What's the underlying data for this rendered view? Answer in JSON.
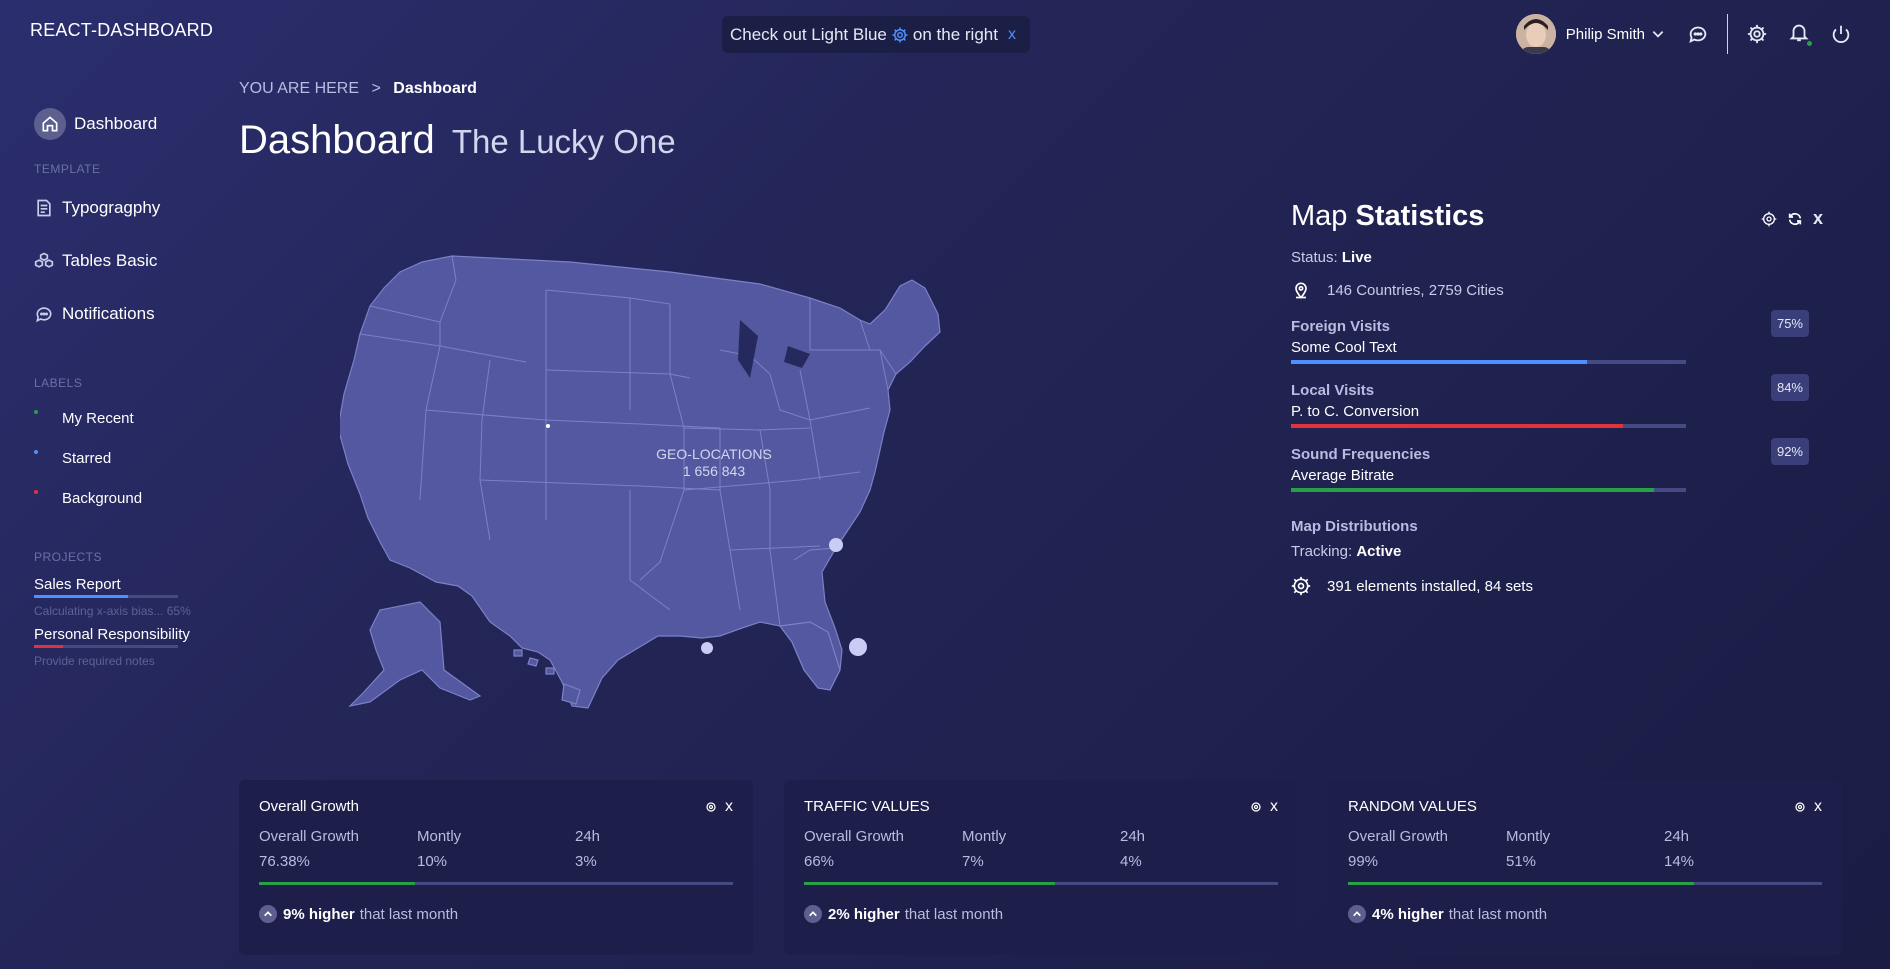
{
  "app": {
    "brand": "REACT-DASHBOARD"
  },
  "toast": {
    "text_before": "Check out Light Blue",
    "text_after": "on the right",
    "close": "x"
  },
  "user": {
    "name": "Philip Smith"
  },
  "sidebar": {
    "items": [
      {
        "label": "Dashboard",
        "icon": "home-icon",
        "active": true
      },
      {
        "label": "Typogragphy",
        "icon": "document-icon"
      },
      {
        "label": "Tables Basic",
        "icon": "cubes-icon"
      },
      {
        "label": "Notifications",
        "icon": "chat-icon"
      }
    ],
    "template_heading": "TEMPLATE",
    "labels_heading": "LABELS",
    "labels": [
      {
        "label": "My Recent",
        "color": "#27a046"
      },
      {
        "label": "Starred",
        "color": "#4d90fe"
      },
      {
        "label": "Background",
        "color": "#e0343d"
      }
    ],
    "projects_heading": "PROJECTS",
    "projects": [
      {
        "name": "Sales Report",
        "note": "Calculating x-axis bias... 65%",
        "progress": 0.65,
        "color": "#4d90fe"
      },
      {
        "name": "Personal Responsibility",
        "note": "Provide required notes",
        "progress": 0.2,
        "color": "#e0343d"
      }
    ]
  },
  "breadcrumb": {
    "prefix": "YOU ARE HERE",
    "separator": ">",
    "current": "Dashboard"
  },
  "page": {
    "title": "Dashboard",
    "subtitle": "The Lucky One"
  },
  "map": {
    "label_line1": "GEO-LOCATIONS",
    "label_line2": "1 656 843"
  },
  "stats": {
    "title_light": "Map",
    "title_bold": "Statistics",
    "close": "x",
    "status_label": "Status:",
    "status_value": "Live",
    "locations": "146 Countries, 2759 Cities",
    "metrics": [
      {
        "title": "Foreign Visits",
        "subtitle": "Some Cool Text",
        "percent_label": "75%",
        "value": 0.75,
        "color": "#4d90fe"
      },
      {
        "title": "Local Visits",
        "subtitle": "P. to C. Conversion",
        "percent_label": "84%",
        "value": 0.84,
        "color": "#e0343d"
      },
      {
        "title": "Sound Frequencies",
        "subtitle": "Average Bitrate",
        "percent_label": "92%",
        "value": 0.92,
        "color": "#27a046"
      }
    ],
    "distributions_title": "Map Distributions",
    "tracking_label": "Tracking:",
    "tracking_value": "Active",
    "installed": "391 elements installed, 84 sets"
  },
  "cards": [
    {
      "title": "Overall Growth",
      "close": "x",
      "col_labels": [
        "Overall Growth",
        "Montly",
        "24h"
      ],
      "col_values": [
        "76.38%",
        "10%",
        "3%"
      ],
      "progress": 0.33,
      "foot_bold": "9% higher",
      "foot_text": "that last month"
    },
    {
      "title": "TRAFFIC VALUES",
      "close": "x",
      "col_labels": [
        "Overall Growth",
        "Montly",
        "24h"
      ],
      "col_values": [
        "66%",
        "7%",
        "4%"
      ],
      "progress": 0.53,
      "foot_bold": "2% higher",
      "foot_text": "that last month"
    },
    {
      "title": "RANDOM VALUES",
      "close": "x",
      "col_labels": [
        "Overall Growth",
        "Montly",
        "24h"
      ],
      "col_values": [
        "99%",
        "51%",
        "14%"
      ],
      "progress": 0.73,
      "foot_bold": "4% higher",
      "foot_text": "that last month"
    }
  ]
}
